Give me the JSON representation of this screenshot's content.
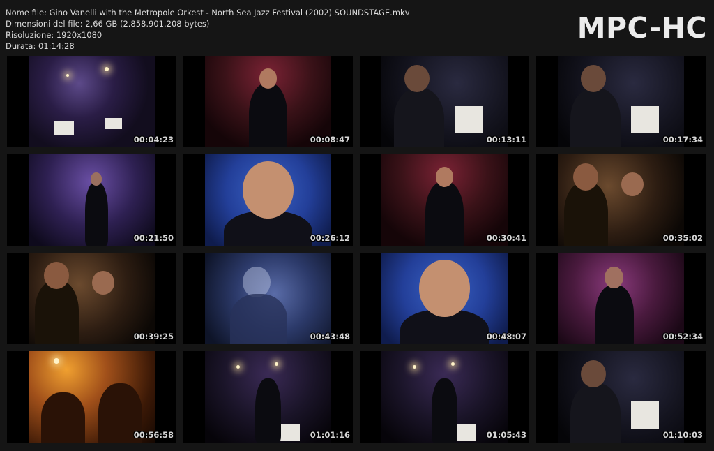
{
  "file_info": {
    "name": "Nome file: Gino Vanelli with the Metropole Orkest - North Sea Jazz Festival (2002) SOUNDSTAGE.mkv",
    "size": "Dimensioni del file: 2,66 GB (2.858.901.208 bytes)",
    "resolution": "Risoluzione: 1920x1080",
    "duration": "Durata: 01:14:28"
  },
  "logo": "MPC-HC",
  "thumbnails": [
    {
      "time": "00:04:23",
      "scene": "stage"
    },
    {
      "time": "00:08:47",
      "scene": "red"
    },
    {
      "time": "00:13:11",
      "scene": "dark"
    },
    {
      "time": "00:17:34",
      "scene": "dark"
    },
    {
      "time": "00:21:50",
      "scene": "purple"
    },
    {
      "time": "00:26:12",
      "scene": "blue"
    },
    {
      "time": "00:30:41",
      "scene": "red"
    },
    {
      "time": "00:35:02",
      "scene": "warm"
    },
    {
      "time": "00:39:25",
      "scene": "warm"
    },
    {
      "time": "00:43:48",
      "scene": "ghost"
    },
    {
      "time": "00:48:07",
      "scene": "blue"
    },
    {
      "time": "00:52:34",
      "scene": "magenta"
    },
    {
      "time": "00:56:58",
      "scene": "orange"
    },
    {
      "time": "01:01:16",
      "scene": "night"
    },
    {
      "time": "01:05:43",
      "scene": "night"
    },
    {
      "time": "01:10:03",
      "scene": "dark"
    }
  ]
}
